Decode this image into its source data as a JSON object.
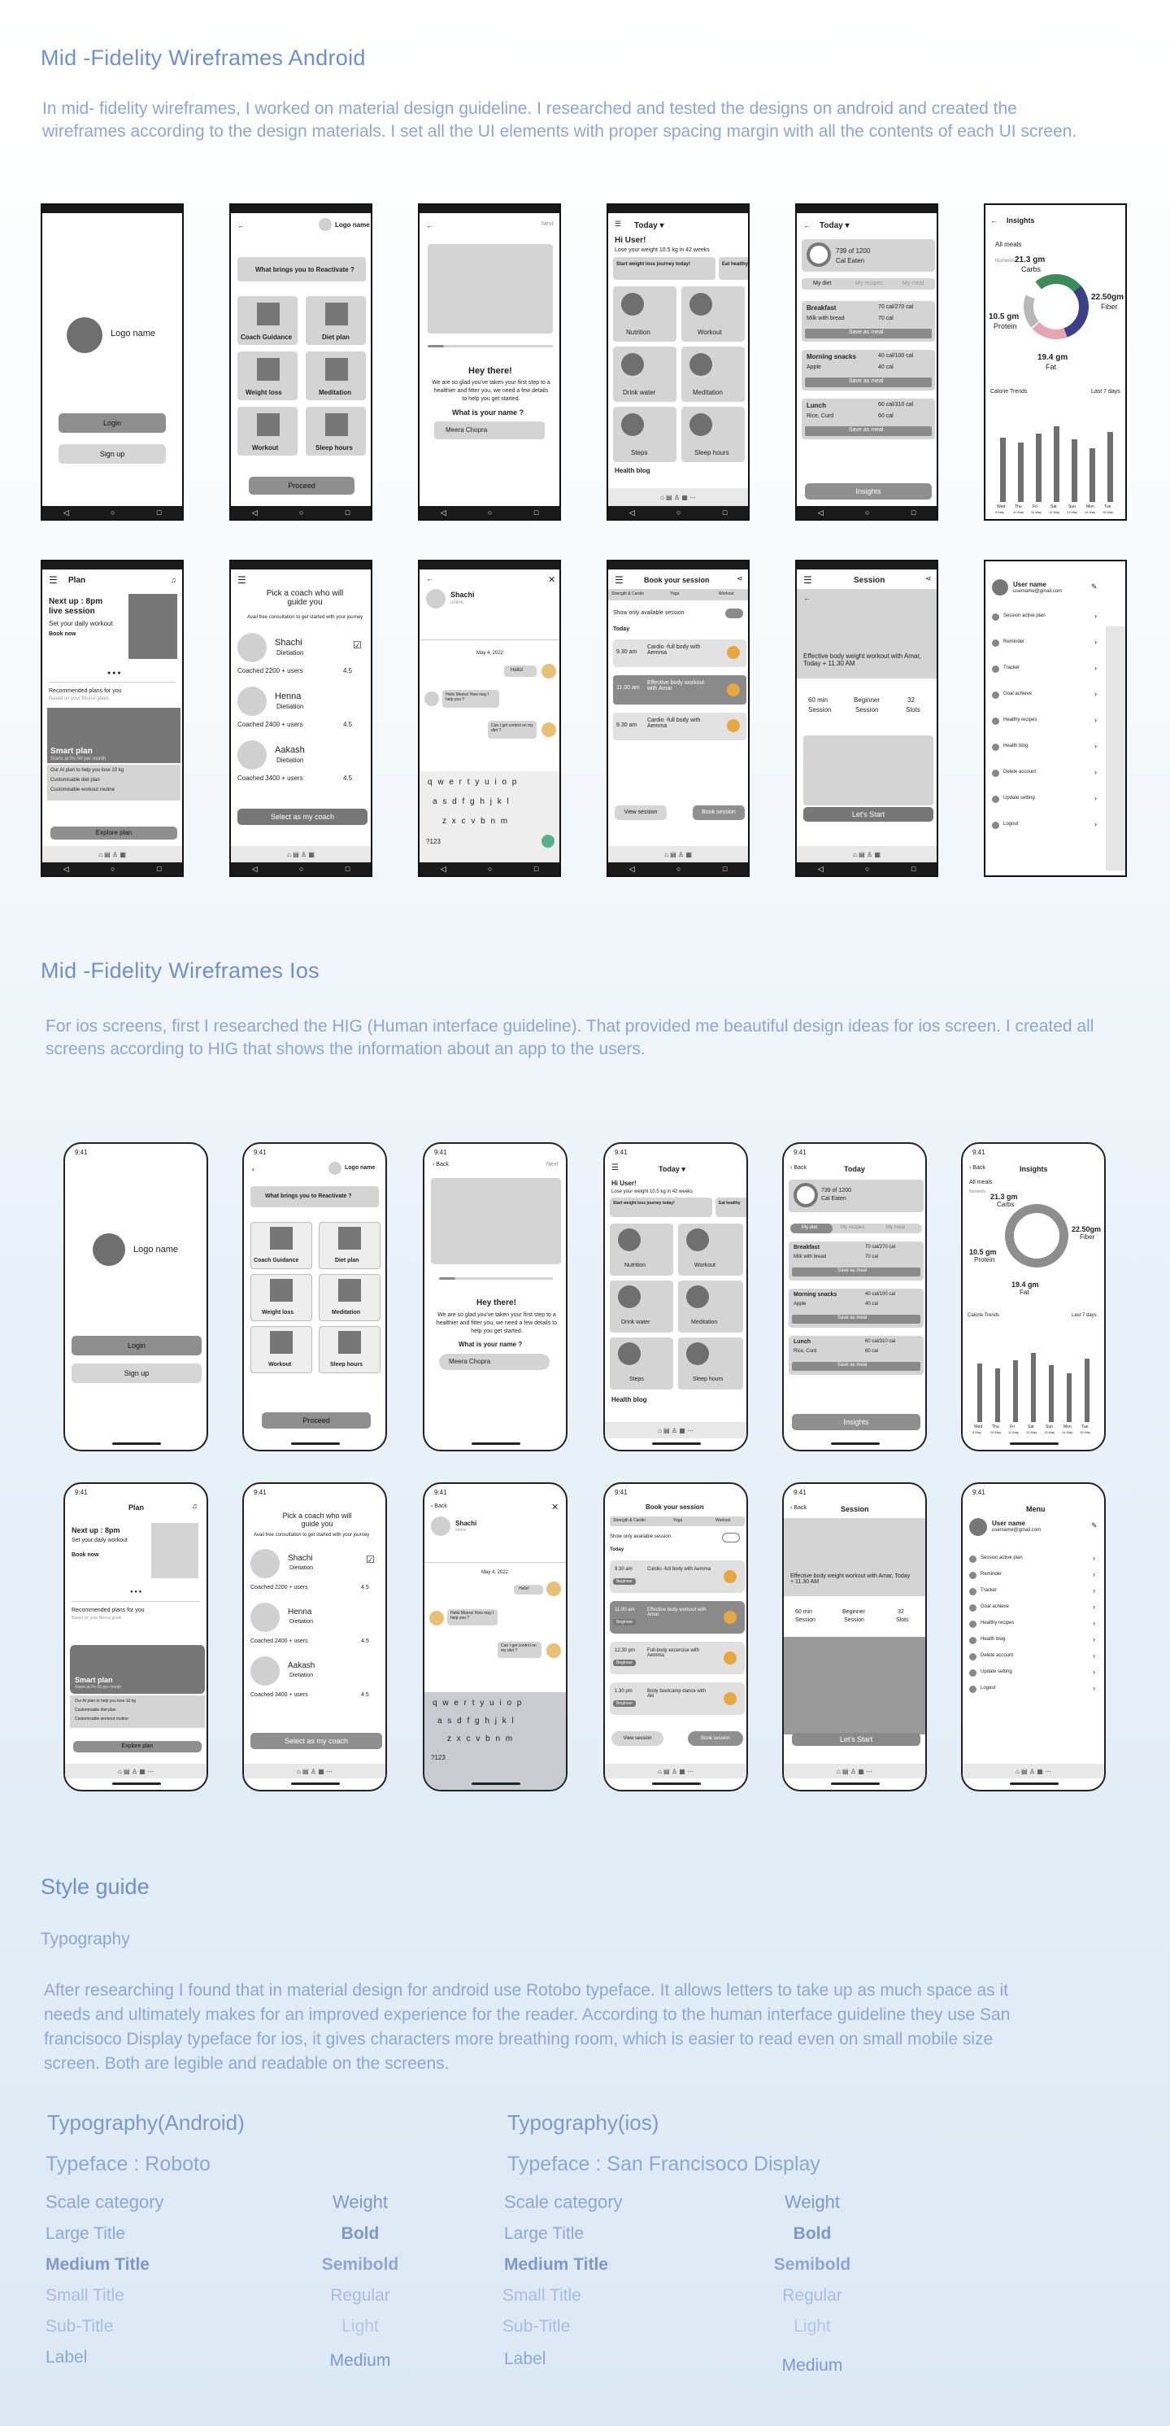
{
  "android": {
    "title": "Mid -Fidelity Wireframes Android",
    "description": "In mid- fidelity wireframes, I worked on material design guideline. I researched and tested the designs on android and created the wireframes according to the design materials. I set all the UI elements with proper spacing margin with all the contents of each UI screen."
  },
  "ios": {
    "title": "Mid -Fidelity Wireframes Ios",
    "description": "For ios screens, first I researched  the HIG (Human interface guideline). That provided me beautiful design ideas for ios screen. I created all screens according to HIG that shows the information about an app to the users."
  },
  "screens": {
    "login": {
      "logo": "Logo name",
      "login": "Login",
      "signup": "Sign up"
    },
    "reactivate": {
      "logo": "Logo name",
      "question": "What brings you to Reactivate ?",
      "options": [
        "Coach Guidance",
        "Diet plan",
        "Weight loss",
        "Meditation",
        "Workout",
        "Sleep hours"
      ],
      "proceed": "Proceed",
      "back": "Back"
    },
    "welcome": {
      "next": "Next",
      "hey": "Hey there!",
      "msg": "We are so glad you've taken your first step to a healthier and fitter you, we need a few details to help you get started.",
      "question": "What is your name ?",
      "name": "Meera Chopra",
      "back": "Back"
    },
    "today": {
      "today": "Today",
      "hi": "Hi User!",
      "lose": "Lose your weight 10.5 kg in 42 weeks",
      "banner1": "Start weight loss journey today!",
      "banner2": "Eat healthy",
      "tiles": [
        "Nutrition",
        "Workout",
        "Drink water",
        "Meditation",
        "Steps",
        "Sleep hours"
      ],
      "blog": "Health blog"
    },
    "meals": {
      "today": "Today",
      "cal": "739 of 1200",
      "calEaten": "Cal Eaten",
      "tabs": [
        "My diet",
        "My recipes",
        "My meal"
      ],
      "items": [
        {
          "name": "Breakfast",
          "cal": "70 cal/270 cal",
          "sub": "Milk with bread",
          "sc": "70 cal"
        },
        {
          "name": "Morning snacks",
          "cal": "40 cal/100 cal",
          "sub": "Apple",
          "sc": "40 cal"
        },
        {
          "name": "Lunch",
          "cal": "60 cal/310 cal",
          "sub": "Rice, Curd",
          "sc": "60 cal"
        }
      ],
      "save": "Save as meal",
      "insights": "Insights"
    },
    "insights": {
      "title": "Insights",
      "all": "All meals",
      "nutrients": "Nutrients",
      "carbs": "21.3 gm",
      "carbsL": "Carbs",
      "fiber": "22.50gm",
      "fiberL": "Fiber",
      "protein": "10.5 gm",
      "proteinL": "Protein",
      "fat": "19.4 gm",
      "fatL": "Fat",
      "trends": "Calorie Trends",
      "last": "Last 7 days",
      "days": [
        "Wed",
        "Thu",
        "Fri",
        "Sat",
        "Sun",
        "Mon",
        "Tue"
      ],
      "dates": [
        "9 May",
        "10 May",
        "11 May",
        "12 May",
        "13 May",
        "14 May",
        "15 May"
      ],
      "values": [
        0.72,
        0.66,
        0.76,
        0.85,
        0.7,
        0.6,
        0.78
      ]
    },
    "plan": {
      "title": "Plan",
      "next": "Next up : 8pm",
      "live": "live session",
      "set": "Set your daily workout",
      "book": "Book now",
      "rec": "Recommended plans for you",
      "based": "Based on your fitness goals",
      "smart": "Smart plan",
      "starts": "Starts at Rs 99 per month",
      "l1": "Our AI plan to help you lose 10 kg",
      "l2": "Customisable diet plan",
      "l3": "Customisable workout routine",
      "explore": "Explore plan"
    },
    "coach": {
      "title": "Pick a coach who will guide you",
      "sub": "Avail free consultation to get started with your journey",
      "coaches": [
        {
          "name": "Shachi",
          "role": "Dietiation",
          "count": "Coached 2200 + users",
          "rating": "4.5"
        },
        {
          "name": "Henna",
          "role": "Dietiation",
          "count": "Coached 2400 + users",
          "rating": "4.5"
        },
        {
          "name": "Aakash",
          "role": "Dietiation",
          "count": "Coached 3400 + users",
          "rating": "4.5"
        }
      ],
      "select": "Select as my coach"
    },
    "chat": {
      "name": "Shachi",
      "status": "online",
      "date": "May 4, 2022",
      "m1": "Hello!",
      "m2": "Hello Meera! How may I help you ?",
      "m3": "Can I get control on my diet ?",
      "keys": [
        "q w e r t y u i o p",
        "a s d f g h j k l",
        "z x c v b n m"
      ],
      "num": "?123",
      "back": "Back"
    },
    "book": {
      "title": "Book your session",
      "tabs": [
        "Strength & Cardio",
        "Yoga",
        "Workout"
      ],
      "toggle": "Show only available session",
      "today": "Today",
      "slots": [
        {
          "time": "9.30 am",
          "name": "Cardio -full body with Aemma"
        },
        {
          "time": "11.00 am",
          "name": "Effective body workout with Amar"
        },
        {
          "time": "12.30 pm",
          "name": "Full-body excercise with Aemma"
        },
        {
          "time": "1.30 pm",
          "name": "Body bootcamp dance with Aki"
        }
      ],
      "tag": "Beginner",
      "view": "View session",
      "bookBtn": "Book session"
    },
    "session": {
      "title": "Session",
      "desc": "Effective body weight workout with Amar, Today + 11.30 AM",
      "stats": [
        "60 min",
        "Beginner",
        "32"
      ],
      "labels": [
        "Session",
        "Session",
        "Slots"
      ],
      "start": "Let's Start",
      "back": "Back"
    },
    "menu": {
      "title": "Menu",
      "user": "User name",
      "email": "username@gmail.com",
      "items": [
        "Session active plan",
        "Reminder",
        "Tracker",
        "Goal achieve",
        "Healthy recipes",
        "Health blog",
        "Delete account",
        "Update setting",
        "Logout"
      ]
    }
  },
  "style": {
    "title": "Style guide",
    "typography": "Typography",
    "description": "After researching I found that in material design for android use Rotobo typeface. It allows letters to take up as much space as it needs and ultimately makes for an improved experience for the reader. According to the human interface guideline they use San francisoco Display typeface for ios, it  gives characters more breathing room, which is easier to read even on small mobile size screen. Both are legible and readable on the screens.",
    "android": {
      "heading": "Typography(Android)",
      "typeface": "Typeface : Roboto"
    },
    "ios": {
      "heading": "Typography(ios)",
      "typeface": "Typeface : San Francisoco Display"
    },
    "scaleHeader": "Scale category",
    "weightHeader": "Weight",
    "rows": [
      {
        "scale": "Large Title",
        "weight": "Bold"
      },
      {
        "scale": "Medium Title",
        "weight": "Semibold"
      },
      {
        "scale": "Small Title",
        "weight": "Regular"
      },
      {
        "scale": "Sub-Title",
        "weight": "Light"
      },
      {
        "scale": "Label",
        "weight": "Medium"
      }
    ]
  },
  "colors": {
    "accent": "#6f8fd0",
    "text": "#8ea6d6"
  }
}
